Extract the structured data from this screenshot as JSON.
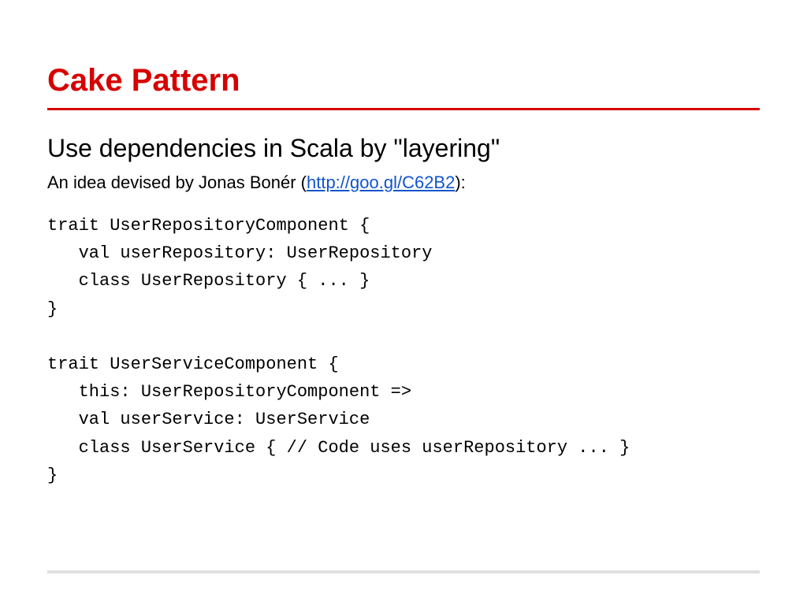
{
  "title": "Cake Pattern",
  "subtitle": "Use dependencies in Scala by \"layering\"",
  "byline": {
    "prefix": "An idea devised by Jonas Bonér (",
    "link_text": "http://goo.gl/C62B2",
    "link_href": "http://goo.gl/C62B2",
    "suffix": "):"
  },
  "code": "trait UserRepositoryComponent {\n   val userRepository: UserRepository\n   class UserRepository { ... }\n}\n\ntrait UserServiceComponent {\n   this: UserRepositoryComponent =>\n   val userService: UserService\n   class UserService { // Code uses userRepository ... }\n}"
}
